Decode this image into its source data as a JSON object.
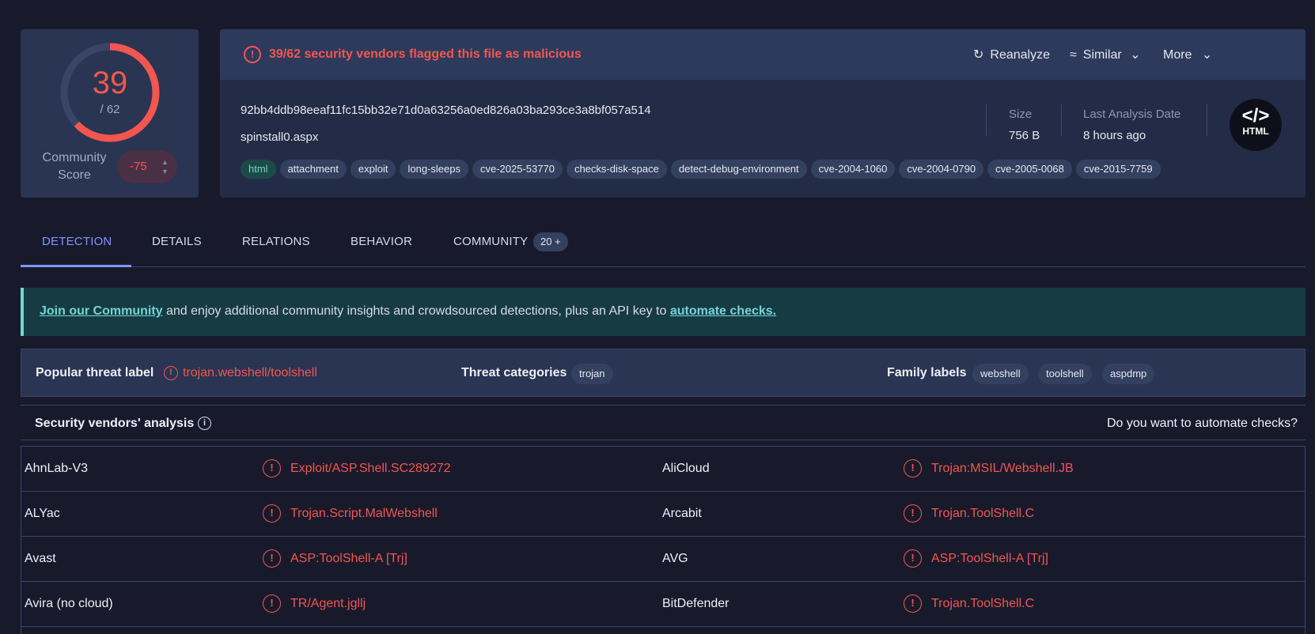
{
  "score": {
    "detected": "39",
    "total": "/ 62",
    "community_label_1": "Community",
    "community_label_2": "Score",
    "community_value": "-75",
    "detected_fraction": 0.629
  },
  "alert": {
    "text": "39/62 security vendors flagged this file as malicious"
  },
  "actions": {
    "reanalyze": "Reanalyze",
    "similar": "Similar",
    "more": "More"
  },
  "file": {
    "hash": "92bb4ddb98eeaf11fc15bb32e71d0a63256a0ed826a03ba293ce3a8bf057a514",
    "name": "spinstall0.aspx",
    "tags": [
      "html",
      "attachment",
      "exploit",
      "long-sleeps",
      "cve-2025-53770",
      "checks-disk-space",
      "detect-debug-environment",
      "cve-2004-1060",
      "cve-2004-0790",
      "cve-2005-0068",
      "cve-2015-7759"
    ],
    "size_label": "Size",
    "size_value": "756 B",
    "date_label": "Last Analysis Date",
    "date_value": "8 hours ago",
    "type_icon": "HTML"
  },
  "tabs": [
    {
      "label": "DETECTION"
    },
    {
      "label": "DETAILS"
    },
    {
      "label": "RELATIONS"
    },
    {
      "label": "BEHAVIOR"
    },
    {
      "label": "COMMUNITY",
      "badge": "20 +"
    }
  ],
  "banner": {
    "link1": "Join our Community",
    "middle": " and enjoy additional community insights and crowdsourced detections, plus an API key to ",
    "link2": "automate checks."
  },
  "threat": {
    "popular_label": "Popular threat label",
    "popular_value": "trojan.webshell/toolshell",
    "categories_label": "Threat categories",
    "categories": [
      "trojan"
    ],
    "family_label": "Family labels",
    "families": [
      "webshell",
      "toolshell",
      "aspdmp"
    ]
  },
  "analysis": {
    "title": "Security vendors' analysis",
    "automate": "Do you want to automate checks?"
  },
  "vendors": [
    {
      "left_name": "AhnLab-V3",
      "left_result": "Exploit/ASP.Shell.SC289272",
      "right_name": "AliCloud",
      "right_result": "Trojan:MSIL/Webshell.JB"
    },
    {
      "left_name": "ALYac",
      "left_result": "Trojan.Script.MalWebshell",
      "right_name": "Arcabit",
      "right_result": "Trojan.ToolShell.C"
    },
    {
      "left_name": "Avast",
      "left_result": "ASP:ToolShell-A [Trj]",
      "right_name": "AVG",
      "right_result": "ASP:ToolShell-A [Trj]"
    },
    {
      "left_name": "Avira (no cloud)",
      "left_result": "TR/Agent.jgllj",
      "right_name": "BitDefender",
      "right_result": "Trojan.ToolShell.C"
    }
  ],
  "colors": {
    "malicious": "#f2564f",
    "accent": "#7f96ff",
    "teal": "#73d6d6"
  }
}
